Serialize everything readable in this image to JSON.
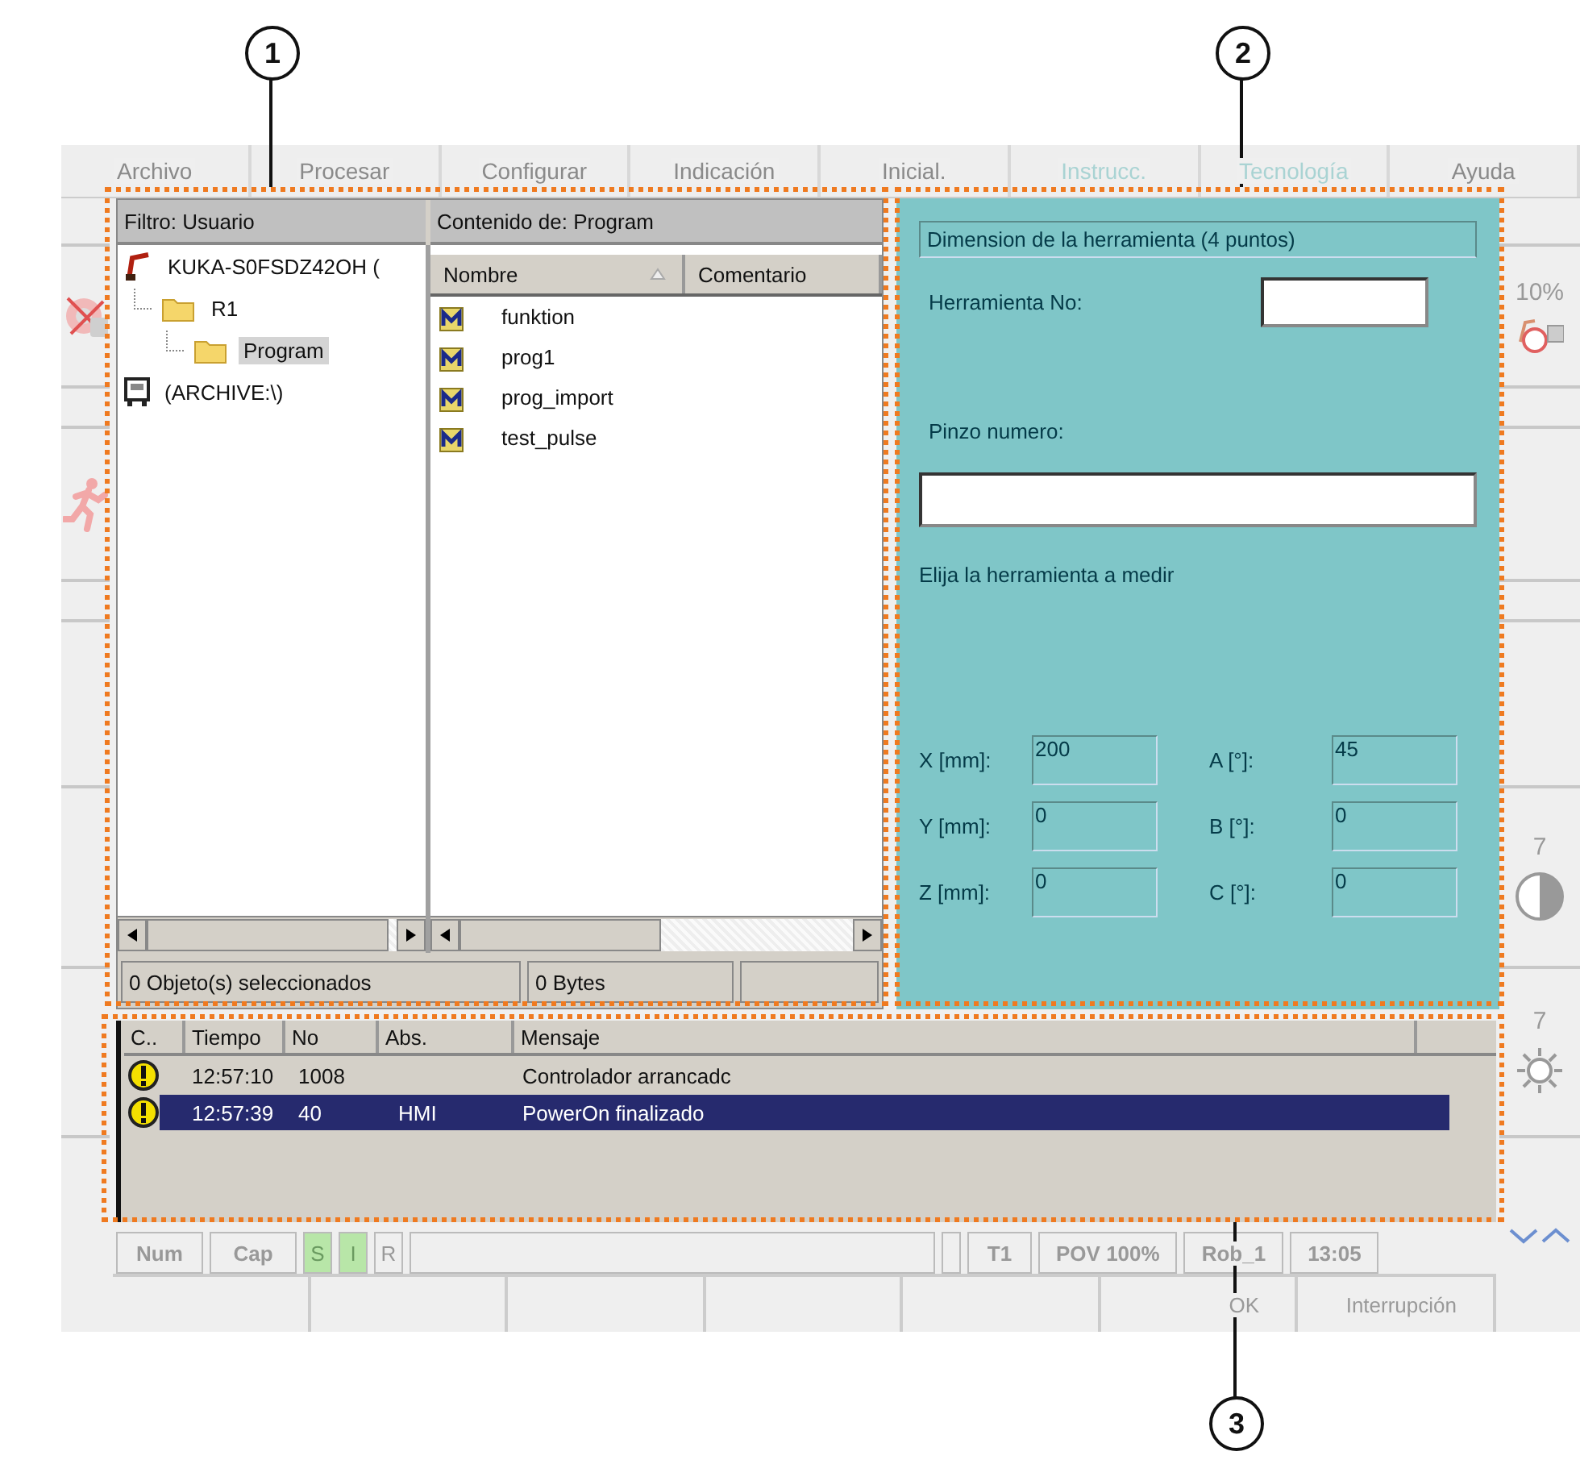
{
  "callouts": [
    {
      "label": "1"
    },
    {
      "label": "2"
    },
    {
      "label": "3"
    }
  ],
  "menu": [
    {
      "label": "Archivo",
      "disabled": false
    },
    {
      "label": "Procesar",
      "disabled": false
    },
    {
      "label": "Configurar",
      "disabled": false
    },
    {
      "label": "Indicación",
      "disabled": false
    },
    {
      "label": "Inicial.",
      "disabled": false
    },
    {
      "label": "Instrucc.",
      "disabled": true
    },
    {
      "label": "Tecnología",
      "disabled": true
    },
    {
      "label": "Ayuda",
      "disabled": false
    }
  ],
  "right_bar": {
    "override": "10%",
    "contrast": "7",
    "brightness": "7"
  },
  "navigator": {
    "filter_header": "Filtro: Usuario",
    "content_header": "Contenido de: Program",
    "tree": [
      {
        "label": "KUKA-S0FSDZ42OH (",
        "kind": "robot",
        "selected": false,
        "children": [
          {
            "label": "R1",
            "kind": "folder",
            "selected": false,
            "children": [
              {
                "label": "Program",
                "kind": "folder",
                "selected": true
              }
            ]
          }
        ]
      },
      {
        "label": "(ARCHIVE:\\)",
        "kind": "drive",
        "selected": false
      }
    ],
    "columns": [
      {
        "label": "Nombre",
        "sorted": true
      },
      {
        "label": "Comentario",
        "sorted": false
      }
    ],
    "files": [
      "funktion",
      "prog1",
      "prog_import",
      "test_pulse"
    ],
    "status": [
      "0 Objeto(s) seleccionados",
      "0 Bytes"
    ]
  },
  "dialog": {
    "title": "Dimension de la herramienta (4 puntos)",
    "tool_label": "Herramienta No:",
    "gripper_label": "Pinzo numero:",
    "hint": "Elija la herramienta a medir",
    "coords": [
      {
        "label": "X [mm]:",
        "value": "200"
      },
      {
        "label": "A [°]:",
        "value": "45"
      },
      {
        "label": "Y [mm]:",
        "value": "0"
      },
      {
        "label": "B [°]:",
        "value": "0"
      },
      {
        "label": "Z [mm]:",
        "value": "0"
      },
      {
        "label": "C [°]:",
        "value": "0"
      }
    ]
  },
  "messages": {
    "columns": [
      "C..",
      "Tiempo",
      "No",
      "Abs.",
      "Mensaje"
    ],
    "rows": [
      {
        "time": "12:57:10",
        "no": "1008",
        "source": "",
        "text": "Controlador arrancadc",
        "selected": false
      },
      {
        "time": "12:57:39",
        "no": "40",
        "source": "HMI",
        "text": "PowerOn finalizado",
        "selected": true
      }
    ]
  },
  "status_bar": [
    {
      "label": "Num",
      "kind": "key",
      "on": false
    },
    {
      "label": "Cap",
      "kind": "key",
      "on": false
    },
    {
      "label": "S",
      "kind": "flag",
      "on": true
    },
    {
      "label": "I",
      "kind": "flag",
      "on": true
    },
    {
      "label": "R",
      "kind": "flag",
      "on": false
    },
    {
      "kind": "spacer"
    },
    {
      "kind": "small"
    },
    {
      "label": "T1",
      "kind": "info"
    },
    {
      "label": "POV 100%",
      "kind": "info"
    },
    {
      "label": "Rob_1",
      "kind": "info"
    },
    {
      "label": "13:05",
      "kind": "info"
    }
  ],
  "softkeys": [
    {
      "label": "OK"
    },
    {
      "label": "Interrupción"
    }
  ]
}
